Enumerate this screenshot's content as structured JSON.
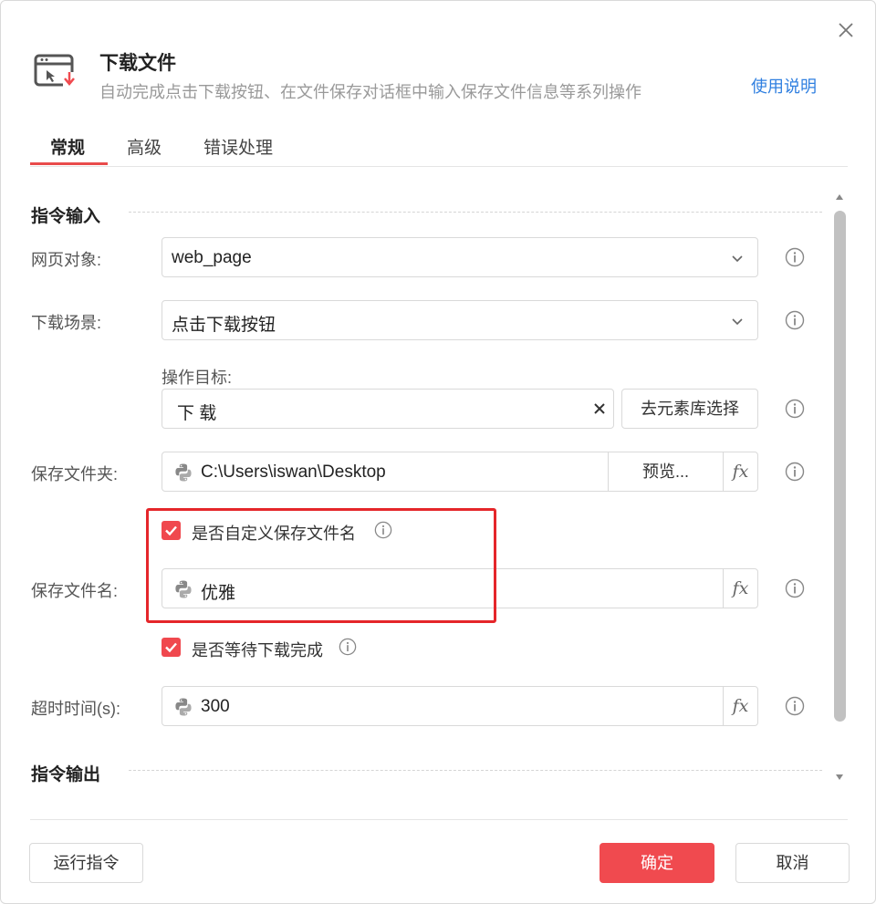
{
  "header": {
    "title": "下载文件",
    "subtitle": "自动完成点击下载按钮、在文件保存对话框中输入保存文件信息等系列操作",
    "help_link": "使用说明"
  },
  "tabs": [
    {
      "label": "常规",
      "active": true
    },
    {
      "label": "高级",
      "active": false
    },
    {
      "label": "错误处理",
      "active": false
    }
  ],
  "sections": {
    "input_title": "指令输入",
    "output_title": "指令输出"
  },
  "fields": {
    "web_object": {
      "label": "网页对象:",
      "value": "web_page"
    },
    "download_scene": {
      "label": "下载场景:",
      "value": "点击下载按钮"
    },
    "operation_target": {
      "label": "操作目标:",
      "value": "下 载",
      "select_button": "去元素库选择"
    },
    "save_folder": {
      "label": "保存文件夹:",
      "value": "C:\\Users\\iswan\\Desktop",
      "browse_button": "预览..."
    },
    "custom_filename": {
      "label": "是否自定义保存文件名",
      "checked": true
    },
    "save_filename": {
      "label": "保存文件名:",
      "value": "优雅"
    },
    "wait_download": {
      "label": "是否等待下载完成",
      "checked": true
    },
    "timeout": {
      "label": "超时时间(s):",
      "value": "300"
    }
  },
  "fx_label": "fx",
  "footer": {
    "run_button": "运行指令",
    "ok_button": "确定",
    "cancel_button": "取消"
  },
  "colors": {
    "accent": "#f04a4f",
    "link": "#2f7fe0",
    "highlight_border": "#e5262a"
  }
}
